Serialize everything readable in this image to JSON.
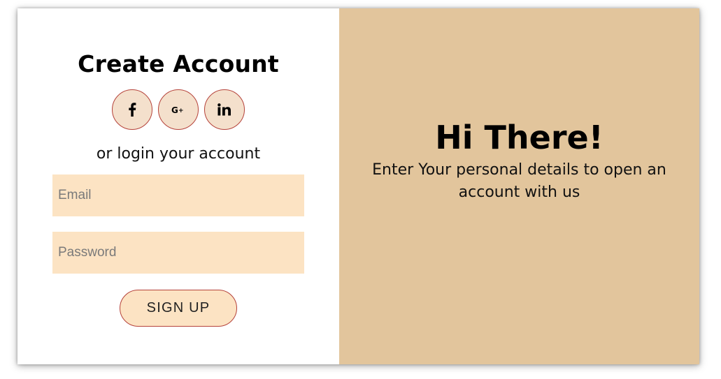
{
  "signup_panel": {
    "title": "Create Account",
    "social_buttons": [
      {
        "icon": "facebook-icon",
        "glyph": "f"
      },
      {
        "icon": "google-plus-icon",
        "glyph": "G+"
      },
      {
        "icon": "linkedin-icon",
        "glyph": "in"
      }
    ],
    "subtitle": "or login your account",
    "email_placeholder": "Email",
    "password_placeholder": "Password",
    "submit_label": "SIGN UP"
  },
  "welcome_panel": {
    "heading": "Hi There!",
    "description": "Enter Your personal details to open an account with us"
  },
  "colors": {
    "panel_background": "#e2c59c",
    "input_background": "#fce3c3",
    "social_background": "#f4e0cc",
    "accent_border": "#b5423a"
  }
}
